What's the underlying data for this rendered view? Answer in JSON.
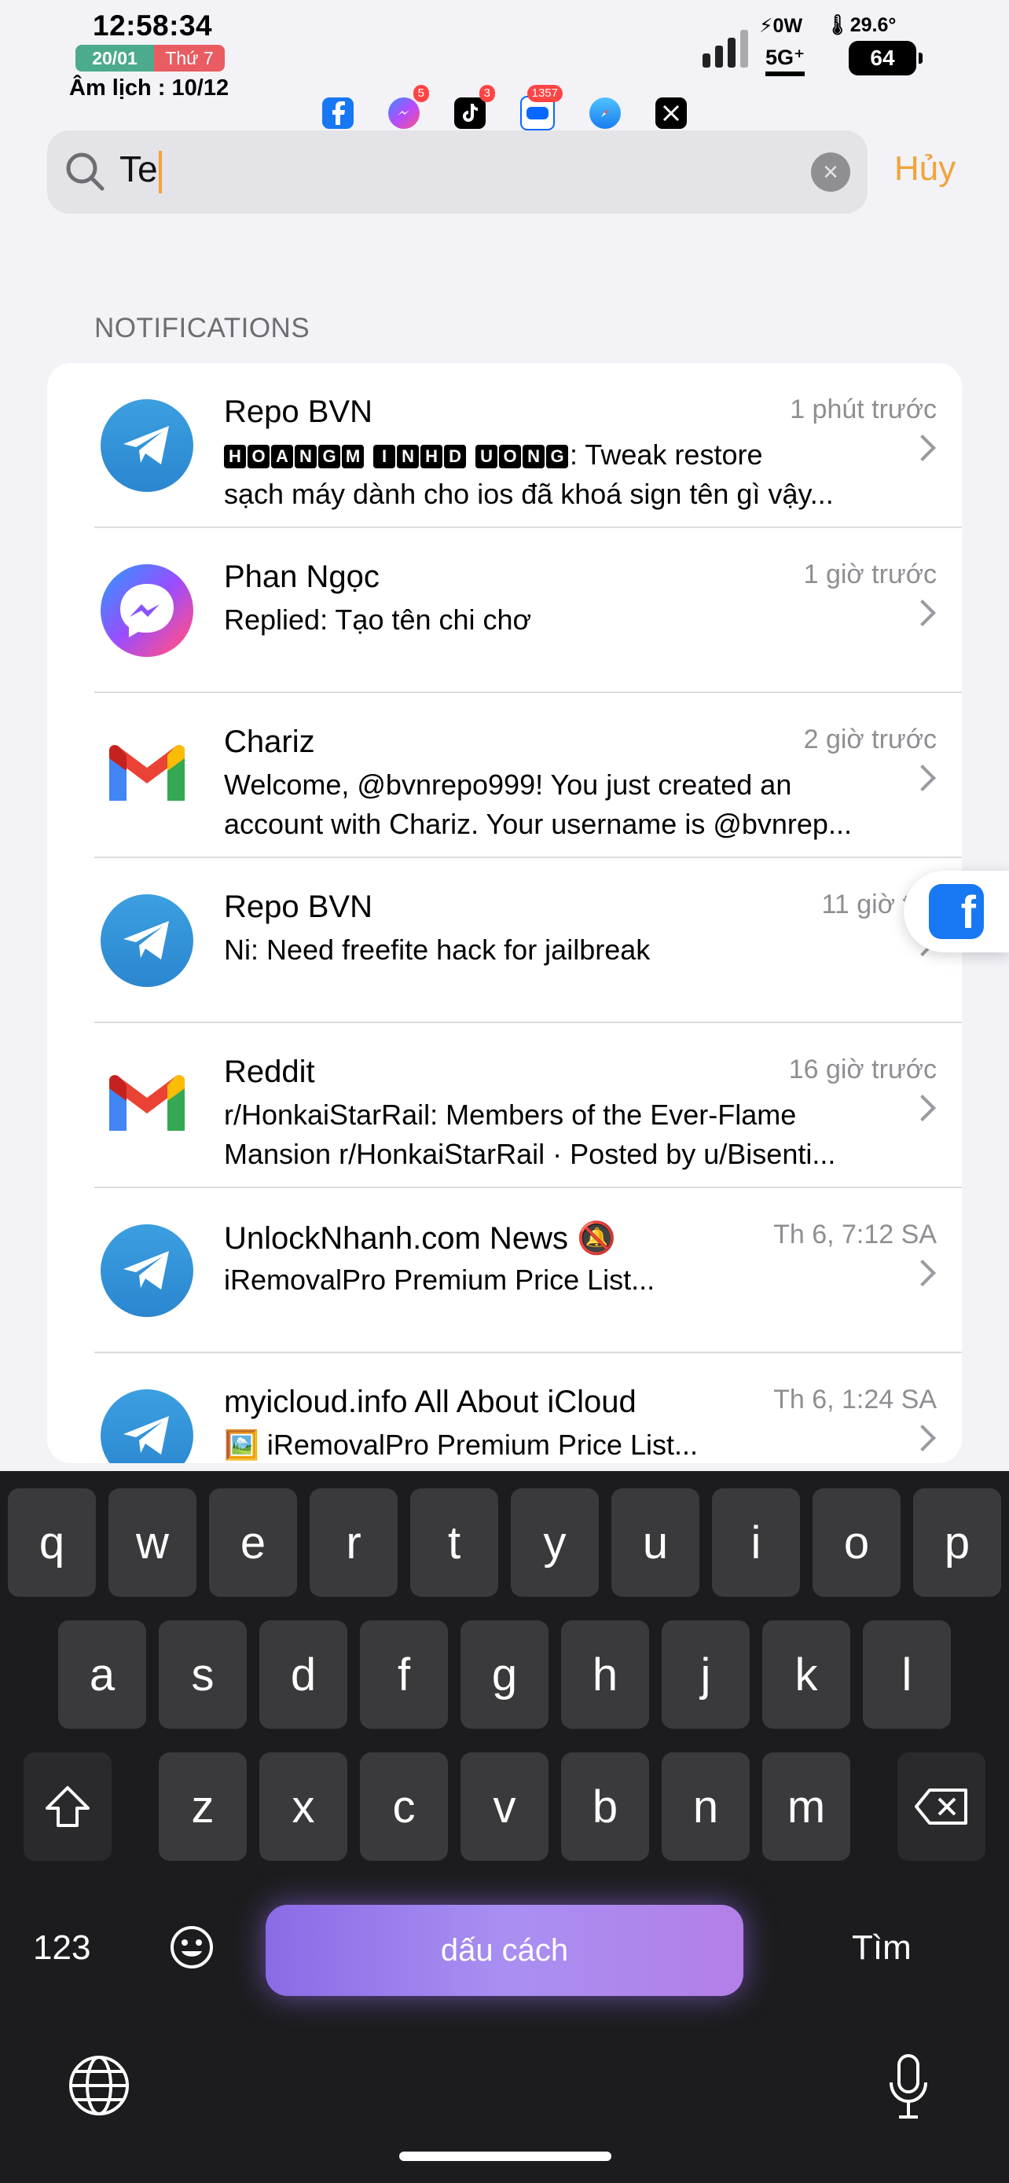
{
  "status": {
    "time": "12:58:34",
    "date": "20/01",
    "weekday": "Thứ 7",
    "lunar": "Âm lịch : 10/12",
    "watts": "⚡0W",
    "temp": "🌡29.6°",
    "network": "5G⁺",
    "battery": "64"
  },
  "app_icons": [
    {
      "name": "facebook",
      "badge": ""
    },
    {
      "name": "messenger",
      "badge": "5"
    },
    {
      "name": "tiktok",
      "badge": "3"
    },
    {
      "name": "zalo",
      "badge": "1357"
    },
    {
      "name": "safari",
      "badge": ""
    },
    {
      "name": "x",
      "badge": ""
    }
  ],
  "search": {
    "value": "Te",
    "cancel_label": "Hủy"
  },
  "section_title": "NOTIFICATIONS",
  "notifications": [
    {
      "app": "telegram",
      "title": "Repo BVN",
      "time": "1 phút trước",
      "line1_prefix": "HOANGMINHDUONG",
      "line1": ": Tweak restore",
      "line2": "sạch máy dành cho ios đã khoá sign tên gì vậy..."
    },
    {
      "app": "messenger",
      "title": "Phan Ngọc",
      "time": "1 giờ trước",
      "line1": "Replied: Tạo tên chi chơ",
      "line2": ""
    },
    {
      "app": "gmail",
      "title": "Chariz",
      "time": "2 giờ trước",
      "line1": "Welcome, @bvnrepo999! You just created an",
      "line2": "account with Chariz. Your username is @bvnrep..."
    },
    {
      "app": "telegram",
      "title": "Repo BVN",
      "time": "11 giờ trư",
      "line1": "Ni: Need freefite hack for jailbreak",
      "line2": ""
    },
    {
      "app": "gmail",
      "title": "Reddit",
      "time": "16 giờ trước",
      "line1": "r/HonkaiStarRail: Members of the Ever-Flame",
      "line2": "Mansion r/HonkaiStarRail · Posted by u/Bisenti..."
    },
    {
      "app": "telegram",
      "title": "UnlockNhanh.com News 🔕",
      "time": "Th 6, 7:12 SA",
      "line1": "iRemovalPro Premium Price List...",
      "line2": ""
    },
    {
      "app": "telegram",
      "title": "myicloud.info All About iCloud",
      "time": "Th 6, 1:24 SA",
      "line1": "🖼️ iRemovalPro Premium Price List...",
      "line2": ""
    }
  ],
  "keyboard": {
    "row1": [
      "q",
      "w",
      "e",
      "r",
      "t",
      "y",
      "u",
      "i",
      "o",
      "p"
    ],
    "row2": [
      "a",
      "s",
      "d",
      "f",
      "g",
      "h",
      "j",
      "k",
      "l"
    ],
    "row3": [
      "z",
      "x",
      "c",
      "v",
      "b",
      "n",
      "m"
    ],
    "numbers_label": "123",
    "space_label": "dấu cách",
    "return_label": "Tìm"
  },
  "colors": {
    "accent": "#f0a43a",
    "telegram": "#2b86d0",
    "keyboard_bg": "#1c1c1e"
  }
}
